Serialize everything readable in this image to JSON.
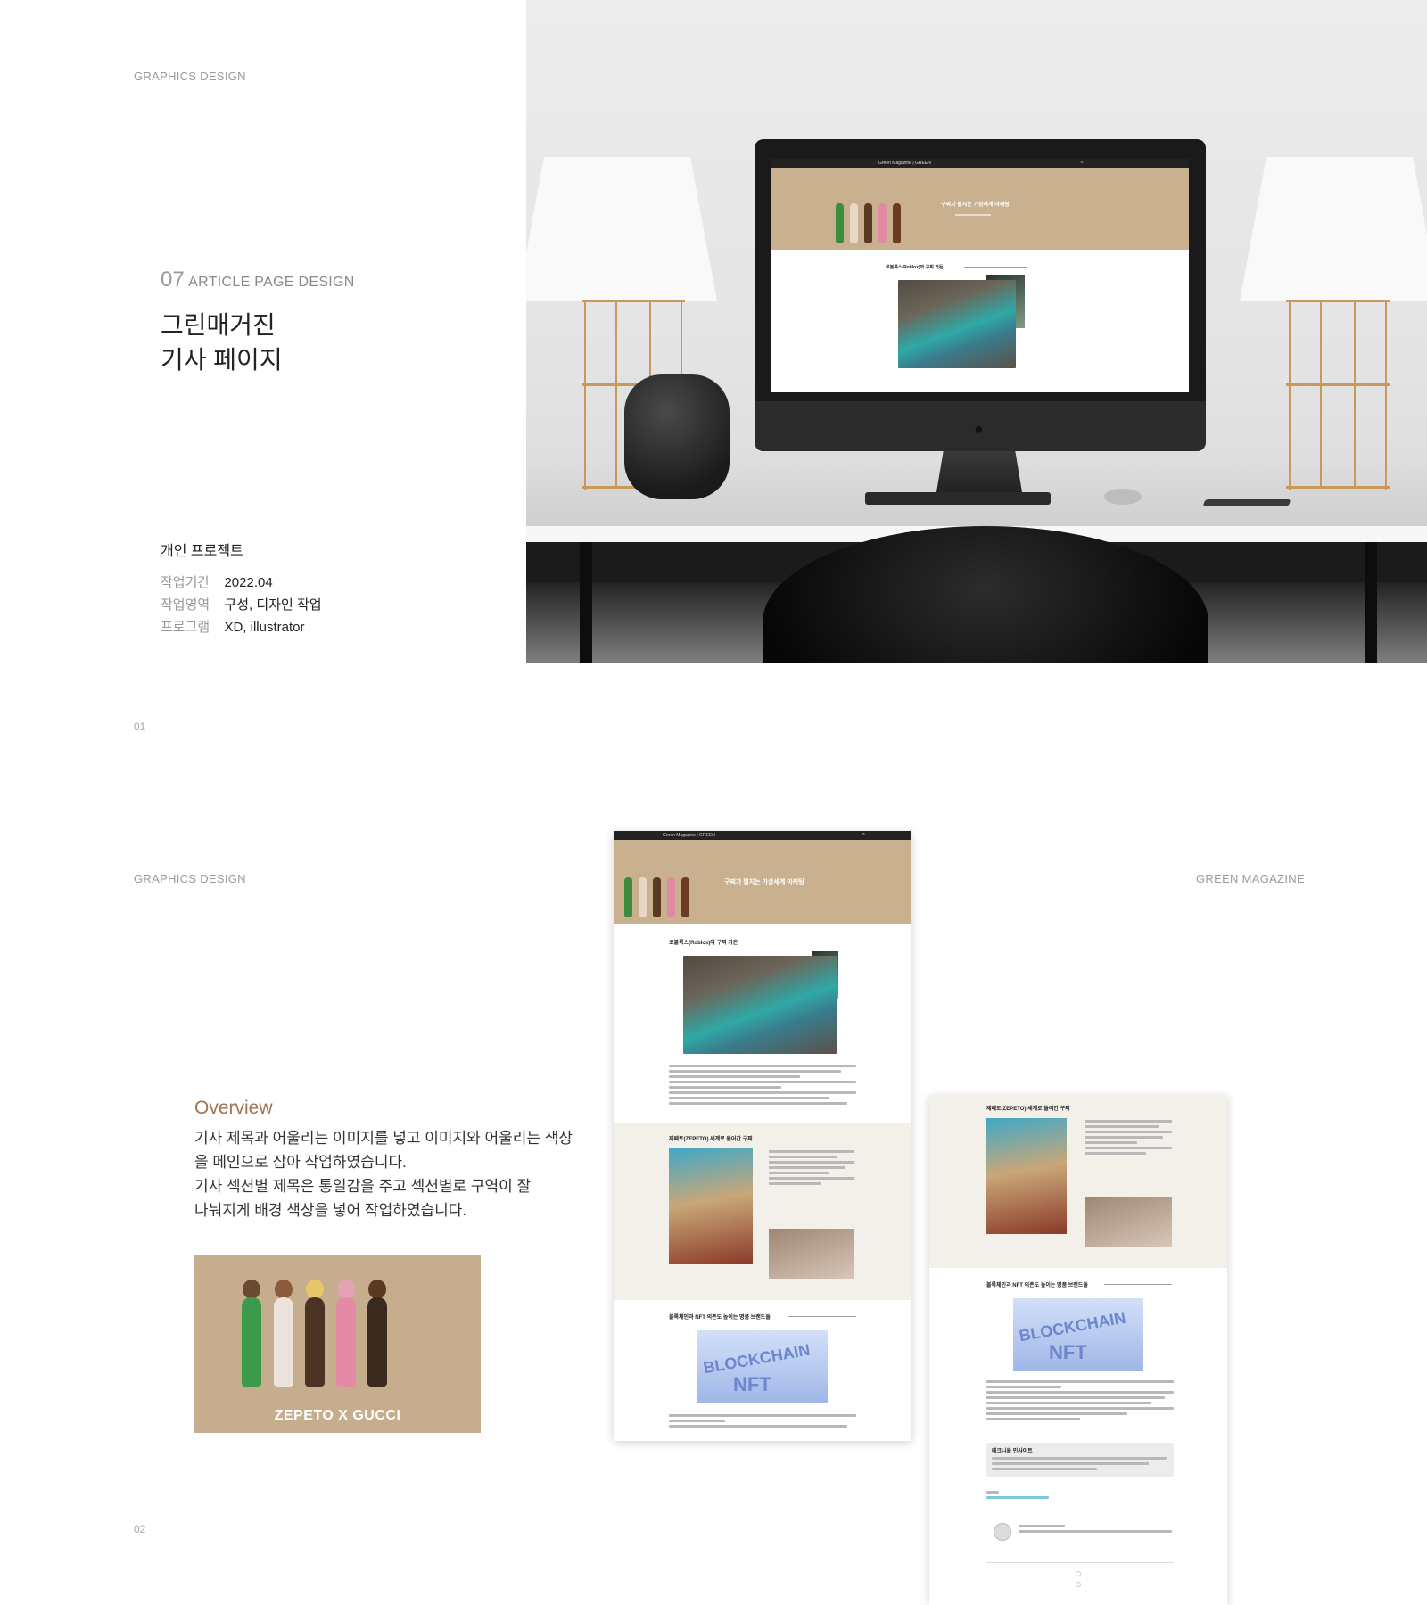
{
  "section1": {
    "category": "GRAPHICS DESIGN",
    "number": "07",
    "title_en": "ARTICLE PAGE DESIGN",
    "title_kr_line1": "그린매거진",
    "title_kr_line2": "기사 페이지",
    "project_type": "개인 프로젝트",
    "details": [
      {
        "key": "작업기간",
        "value": "2022.04"
      },
      {
        "key": "작업영역",
        "value": "구성, 디자인 작업"
      },
      {
        "key": "프로그램",
        "value": "XD, illustrator"
      }
    ],
    "page_number": "01"
  },
  "section2": {
    "category": "GRAPHICS DESIGN",
    "brand": "GREEN MAGAZINE",
    "overview_heading": "Overview",
    "overview_lines": [
      "기사 제목과 어울리는 이미지를 넣고 이미지와 어울리는 색상",
      "을 메인으로 잡아 작업하였습니다.",
      "기사 섹션별 제목은 통일감을 주고 섹션별로 구역이 잘",
      "나눠지게 배경 색상을 넣어 작업하였습니다."
    ],
    "image_caption": "ZEPETO X GUCCI",
    "page_number": "02"
  },
  "mockup": {
    "nav_brand": "Green Magazine | GREEN",
    "hero_title": "구찌가 펼치는 가상세계 마케팅",
    "section_roblox": "로블록스(Roblox)와 구찌 가든",
    "section_zepeto": "제페토(ZEPETO) 세계로 들어간 구찌",
    "section_blockchain": "블록체인과 NFT 의존도 높이는 명품 브랜드들",
    "section_insight": "테크니들 인사이트",
    "blockchain_word1": "BLOCKCHAIN",
    "blockchain_word2": "NFT"
  },
  "colors": {
    "accent_brown": "#9c7650",
    "hero_beige": "#c9b08f",
    "section_beige": "#f3efe9",
    "lamp_gold": "#c9995c"
  }
}
